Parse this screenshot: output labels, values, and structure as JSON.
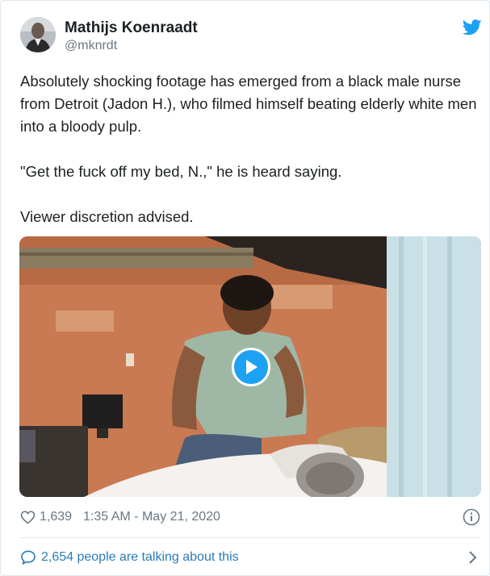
{
  "author": {
    "name": "Mathijs Koenraadt",
    "handle": "@mknrdt"
  },
  "tweet": {
    "paragraphs": [
      "Absolutely shocking footage has emerged from a black male nurse from Detroit (Jadon H.), who filmed himself beating elderly white men into a bloody pulp.",
      "\"Get the fuck off my bed, N.,\" he is heard saying.",
      "Viewer discretion advised."
    ]
  },
  "media": {
    "type": "video",
    "play_icon": "play-icon"
  },
  "meta": {
    "likes": "1,639",
    "timestamp": "1:35 AM - May 21, 2020"
  },
  "footer": {
    "talking": "2,654 people are talking about this"
  },
  "colors": {
    "brand_blue": "#1da1f2",
    "link_blue": "#2b7bb9",
    "muted": "#697882",
    "text": "#1c2022",
    "border": "#e1e8ed"
  },
  "icons": [
    "twitter-bird-icon",
    "heart-icon",
    "info-icon",
    "comment-bubble-icon",
    "chevron-right-icon",
    "play-icon"
  ]
}
